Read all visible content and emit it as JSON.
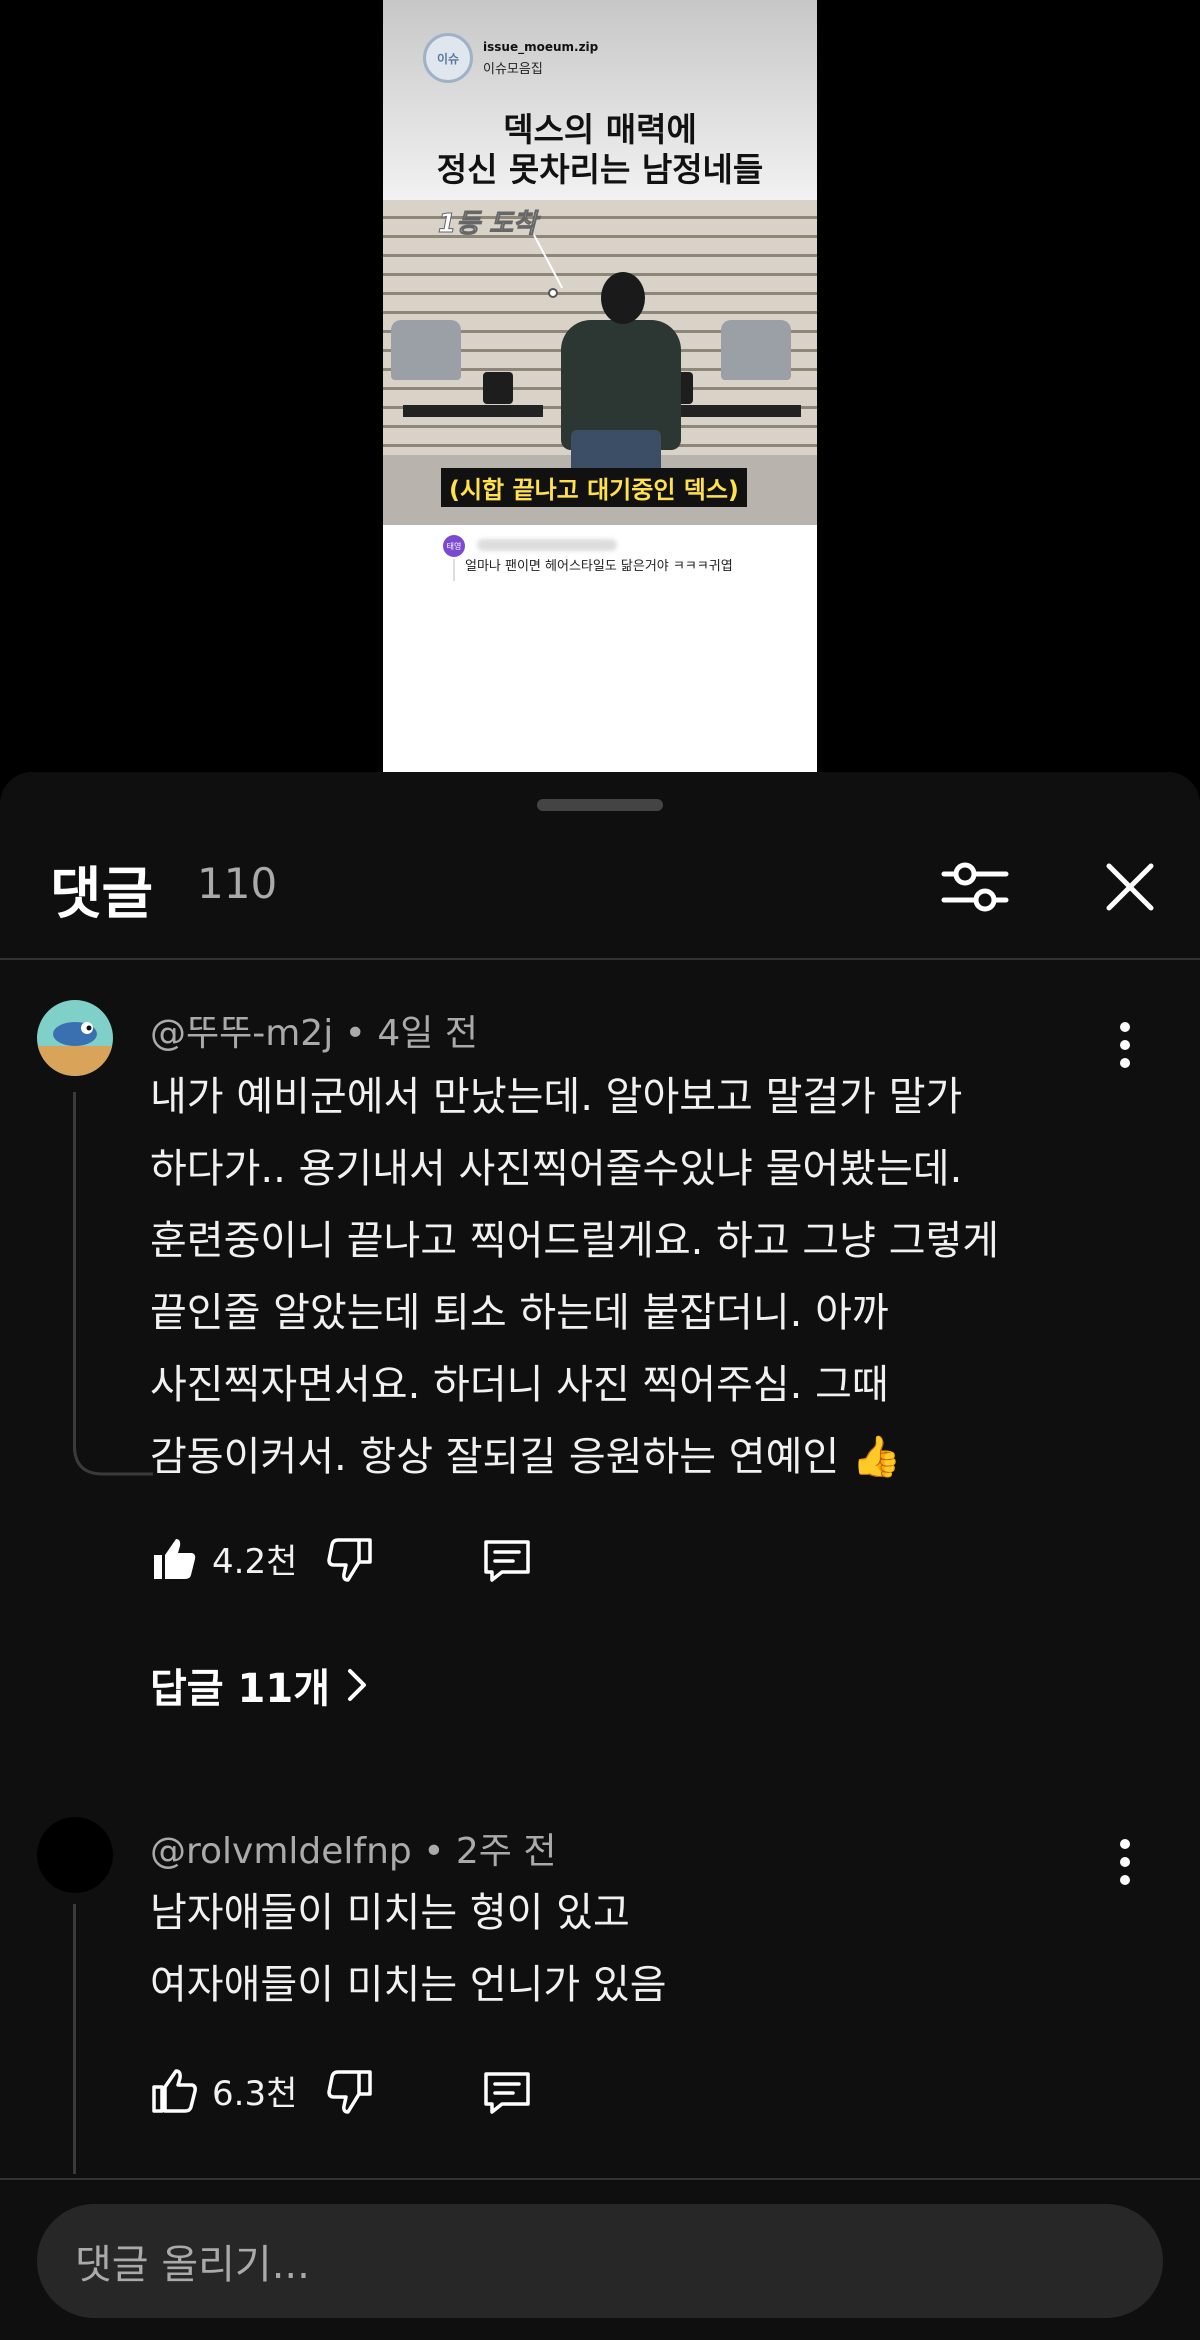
{
  "video": {
    "channel_handle": "issue_moeum.zip",
    "channel_name": "이슈모음집",
    "title_line1": "덱스의 매력에",
    "title_line2": "정신 못차리는 남정네들",
    "label_first": "1등 도착",
    "caption": "(시합 끝나고 대기중인 덱스)",
    "snippet_avatar_text": "태영",
    "snippet_text": "얼마나 팬이면 헤어스타일도 닮은거야 ㅋㅋㅋ귀엽"
  },
  "sheet": {
    "title": "댓글",
    "count": "110",
    "filter_icon": "filter-sliders-icon",
    "close_icon": "close-icon"
  },
  "comments": [
    {
      "author": "@뚜뚜-m2j",
      "time": "4일 전",
      "lines": [
        "내가 예비군에서 만났는데. 알아보고 말걸가 말가",
        "하다가.. 용기내서 사진찍어줄수있냐 물어봤는데.",
        "훈련중이니 끝나고 찍어드릴게요. 하고 그냥 그렇게",
        "끝인줄 알았는데 퇴소 하는데 붙잡더니. 아까",
        "사진찍자면서요. 하더니 사진 찍어주심. 그때",
        "감동이커서. 항상 잘되길 응원하는 연예인 👍"
      ],
      "likes": "4.2천",
      "liked": true,
      "replies": "답글 11개"
    },
    {
      "author": "@rolvmldelfnp",
      "time": "2주 전",
      "lines": [
        "남자애들이 미치는 형이 있고",
        "여자애들이 미치는 언니가 있음"
      ],
      "likes": "6.3천",
      "liked": false
    }
  ],
  "input": {
    "placeholder": "댓글 올리기..."
  },
  "colors": {
    "sheet_bg": "#0f0f0f",
    "caption_text": "#ffe14d"
  }
}
